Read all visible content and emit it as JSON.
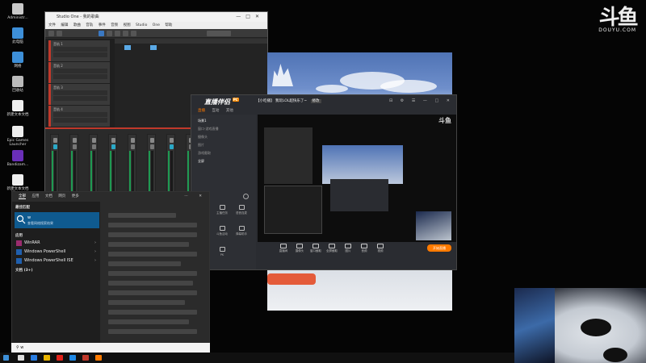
{
  "desktop": {
    "icons": [
      {
        "label": "Administr...",
        "color": "#c9c9c9"
      },
      {
        "label": "此电脑",
        "color": "#3d8fd8"
      },
      {
        "label": "网络",
        "color": "#3d8fd8"
      },
      {
        "label": "回收站",
        "color": "#bbbbbb"
      },
      {
        "label": "新建文本文档",
        "color": "#f0f0f0"
      },
      {
        "label": "Epic Games Launcher",
        "color": "#eeeeee"
      },
      {
        "label": "Bandizam...",
        "color": "#6a2fb8"
      },
      {
        "label": "新建文本文档 Micro...",
        "color": "#f0f0f0"
      }
    ]
  },
  "watermark": {
    "logo": "斗鱼",
    "sub": "DOUYU.COM"
  },
  "studio": {
    "title": "Studio One - 我的歌曲",
    "menu": "文件 编辑 歌曲 音轨 事件 音频 视图 Studio One 帮助",
    "tracks": [
      {
        "label": "音轨 1"
      },
      {
        "label": "音轨 2"
      },
      {
        "label": "音轨 3"
      },
      {
        "label": "音轨 4"
      }
    ]
  },
  "client": {
    "brand": "直播伴侣",
    "brand_tag": "PC",
    "room_title": "【小吃播】 我玩LOL超快乐了~",
    "room_edit": "修改",
    "controls": "⊟ ⚙ ☰ — □ ✕",
    "tabs": [
      "直播",
      "互动",
      "其他"
    ],
    "scenes": [
      {
        "label": "场景1",
        "on": true
      },
      {
        "label": "窗口-游戏直播",
        "on": false
      },
      {
        "label": "摄像头",
        "on": false
      },
      {
        "label": "图片",
        "on": false
      },
      {
        "label": "游戏截取",
        "on": false
      },
      {
        "label": "全屏",
        "on": true
      }
    ],
    "toolbox_label": "工具箱",
    "tools": [
      "直播画面",
      "主播任务",
      "语音连麦",
      "直播答题",
      "斗鱼活动",
      "弹幕助手",
      "PK"
    ],
    "bottom_actions": [
      "直播间",
      "摄像头",
      "窗口截取",
      "全屏截取",
      "图片",
      "音频",
      "视频"
    ],
    "live_button": "开始直播"
  },
  "start": {
    "filters": [
      "全部",
      "应用",
      "文档",
      "网页",
      "更多"
    ],
    "filter_right": "⋯ ✕",
    "best_match_title": "最佳匹配",
    "best_match": {
      "name": "w",
      "sub": "查看网络搜索结果"
    },
    "apps_title": "应用",
    "apps": [
      {
        "name": "WinRAR",
        "color": "#9b2c6e"
      },
      {
        "name": "Windows PowerShell",
        "color": "#1f5fae"
      },
      {
        "name": "Windows PowerShell ISE",
        "color": "#1f5fae"
      }
    ],
    "docs_title": "文档 (3+)",
    "search_text": "w"
  },
  "colors": {
    "accent_orange": "#ff7a00",
    "studio_red": "#c0392b",
    "start_highlight": "#0f5a8f"
  }
}
